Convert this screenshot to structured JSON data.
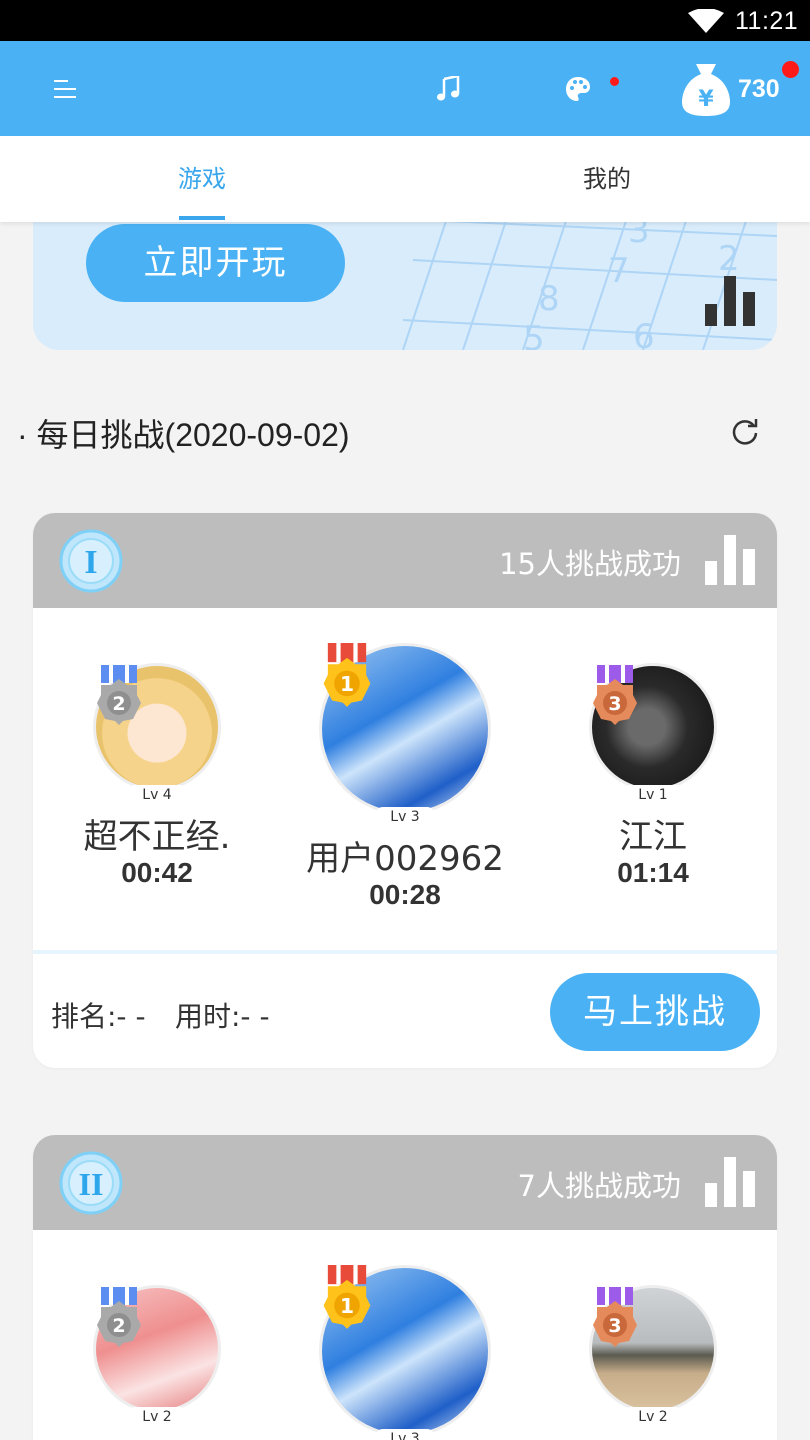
{
  "status_bar": {
    "time": "11:21"
  },
  "app_bar": {
    "coins": "730"
  },
  "tabs": [
    {
      "label": "游戏",
      "active": true
    },
    {
      "label": "我的",
      "active": false
    }
  ],
  "banner": {
    "play_label": "立即开玩"
  },
  "daily": {
    "title": "· 每日挑战(2020-09-02)"
  },
  "cards": [
    {
      "level": "I",
      "success_text": "15人挑战成功",
      "players": [
        {
          "rank": "2",
          "level": "Lv 4",
          "name": "超不正经.",
          "time": "00:42"
        },
        {
          "rank": "1",
          "level": "Lv 3",
          "name": "用户002962",
          "time": "00:28"
        },
        {
          "rank": "3",
          "level": "Lv 1",
          "name": "江江",
          "time": "01:14"
        }
      ],
      "my_rank": "排名:- -",
      "my_time": "用时:- -",
      "challenge_label": "马上挑战"
    },
    {
      "level": "II",
      "success_text": "7人挑战成功",
      "players": [
        {
          "rank": "2",
          "level": "Lv 2",
          "name": "",
          "time": ""
        },
        {
          "rank": "1",
          "level": "Lv 3",
          "name": "",
          "time": ""
        },
        {
          "rank": "3",
          "level": "Lv 2",
          "name": "",
          "time": ""
        }
      ]
    }
  ],
  "colors": {
    "primary": "#4ab2f4",
    "header_gray": "#bdbdbd",
    "tab_active": "#3aa6ec"
  }
}
